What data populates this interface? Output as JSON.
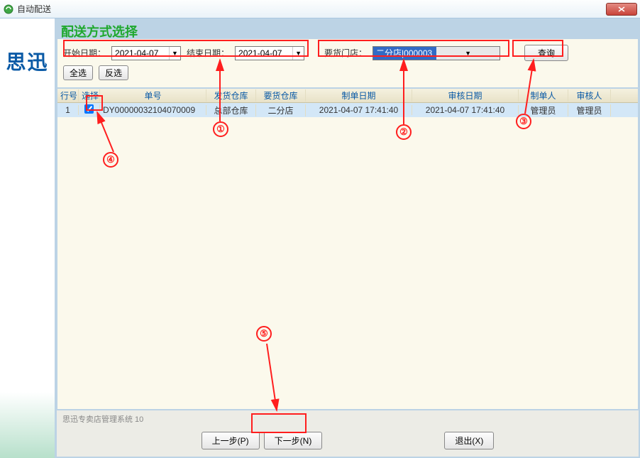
{
  "window": {
    "title": "自动配送",
    "logo": "思迅"
  },
  "panel": {
    "title": "配送方式选择"
  },
  "filter": {
    "start_label": "开始日期：",
    "start_value": "2021-04-07",
    "end_label": "结束日期：",
    "end_value": "2021-04-07",
    "store_label": "要货门店：",
    "store_value": "二分店|000003",
    "query_btn": "查询",
    "select_all_btn": "全选",
    "invert_btn": "反选"
  },
  "columns": {
    "idx": "行号",
    "sel": "选择",
    "no": "单号",
    "fw": "发货仓库",
    "rw": "要货仓库",
    "md": "制单日期",
    "ad": "审核日期",
    "mk": "制单人",
    "ak": "审核人"
  },
  "rows": [
    {
      "idx": "1",
      "sel": true,
      "no": "DY00000032104070009",
      "fw": "总部仓库",
      "rw": "二分店",
      "md": "2021-04-07 17:41:40",
      "ad": "2021-04-07 17:41:40",
      "mk": "管理员",
      "ak": "管理员"
    }
  ],
  "footer": {
    "status": "思迅专卖店管理系统 10",
    "prev": "上一步(P)",
    "next": "下一步(N)",
    "exit": "退出(X)"
  },
  "annotations": {
    "a1": "①",
    "a2": "②",
    "a3": "③",
    "a4": "④",
    "a5": "⑤"
  }
}
